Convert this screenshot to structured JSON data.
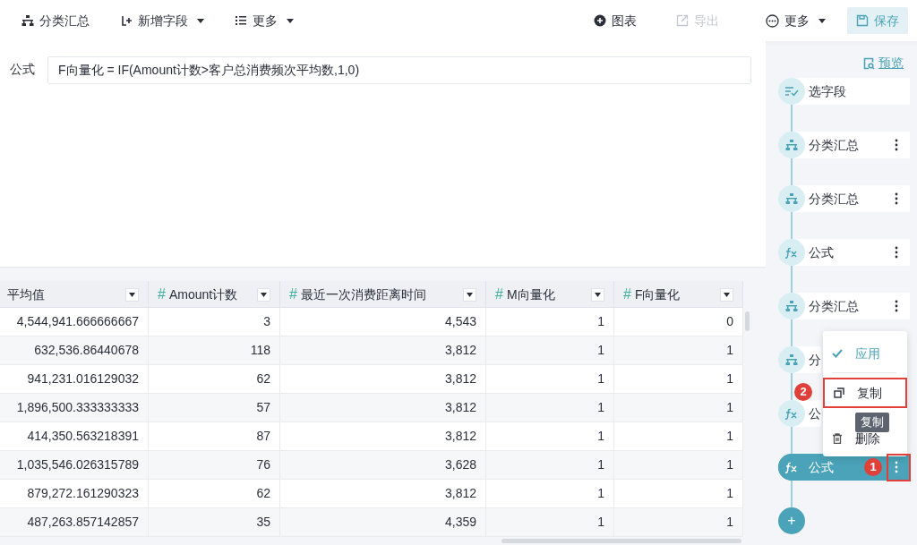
{
  "toolbar": {
    "left": [
      {
        "kind": "group",
        "label": "分类汇总",
        "caret": false
      },
      {
        "kind": "add",
        "label": "新增字段",
        "caret": true
      },
      {
        "kind": "list",
        "label": "更多",
        "caret": true
      }
    ],
    "right": [
      {
        "kind": "chart",
        "label": "图表",
        "disabled": false,
        "caret": false,
        "primary": false
      },
      {
        "kind": "export",
        "label": "导出",
        "disabled": true,
        "caret": false,
        "primary": false
      },
      {
        "kind": "more",
        "label": "更多",
        "disabled": false,
        "caret": true,
        "primary": false
      },
      {
        "kind": "save",
        "label": "保存",
        "disabled": false,
        "caret": false,
        "primary": true
      }
    ]
  },
  "formula": {
    "label": "公式",
    "value": "F向量化 = IF(Amount计数>客户总消费频次平均数,1,0)"
  },
  "table": {
    "columns": [
      {
        "label": "平均值"
      },
      {
        "type_mark": "#",
        "label": "Amount计数"
      },
      {
        "type_mark": "#",
        "label": "最近一次消费距离时间"
      },
      {
        "type_mark": "#",
        "label": "M向量化"
      },
      {
        "type_mark": "#",
        "label": "F向量化"
      }
    ],
    "rows": [
      [
        "4,544,941.666666667",
        "3",
        "4,543",
        "1",
        "0"
      ],
      [
        "632,536.86440678",
        "118",
        "3,812",
        "1",
        "1"
      ],
      [
        "941,231.016129032",
        "62",
        "3,812",
        "1",
        "1"
      ],
      [
        "1,896,500.333333333",
        "57",
        "3,812",
        "1",
        "1"
      ],
      [
        "414,350.563218391",
        "87",
        "3,812",
        "1",
        "1"
      ],
      [
        "1,035,546.026315789",
        "76",
        "3,628",
        "1",
        "1"
      ],
      [
        "879,272.161290323",
        "62",
        "3,812",
        "1",
        "1"
      ],
      [
        "487,263.857142857",
        "35",
        "4,359",
        "1",
        "1"
      ]
    ]
  },
  "steps_panel": {
    "preview": "预览",
    "steps": [
      {
        "kind": "select",
        "label": "选字段",
        "menu": false,
        "selected": false
      },
      {
        "kind": "group",
        "label": "分类汇总",
        "menu": true,
        "selected": false
      },
      {
        "kind": "group",
        "label": "分类汇总",
        "menu": true,
        "selected": false
      },
      {
        "kind": "formula",
        "label": "公式",
        "menu": true,
        "selected": false
      },
      {
        "kind": "group",
        "label": "分类汇总",
        "menu": true,
        "selected": false
      },
      {
        "kind": "group",
        "label": "分",
        "menu": false,
        "selected": false
      },
      {
        "kind": "formula",
        "label": "公",
        "menu": false,
        "selected": false
      },
      {
        "kind": "formula",
        "label": "公式",
        "menu": true,
        "selected": true
      }
    ],
    "add_button": "+"
  },
  "context_menu": {
    "items": [
      {
        "kind": "apply",
        "label": "应用",
        "highlighted": false
      },
      {
        "kind": "copy",
        "label": "复制",
        "highlighted": true
      },
      {
        "kind": "delete",
        "label": "删除",
        "highlighted": false
      }
    ],
    "tooltip": "复制"
  },
  "annotations": [
    {
      "label": "1"
    },
    {
      "label": "2"
    }
  ]
}
